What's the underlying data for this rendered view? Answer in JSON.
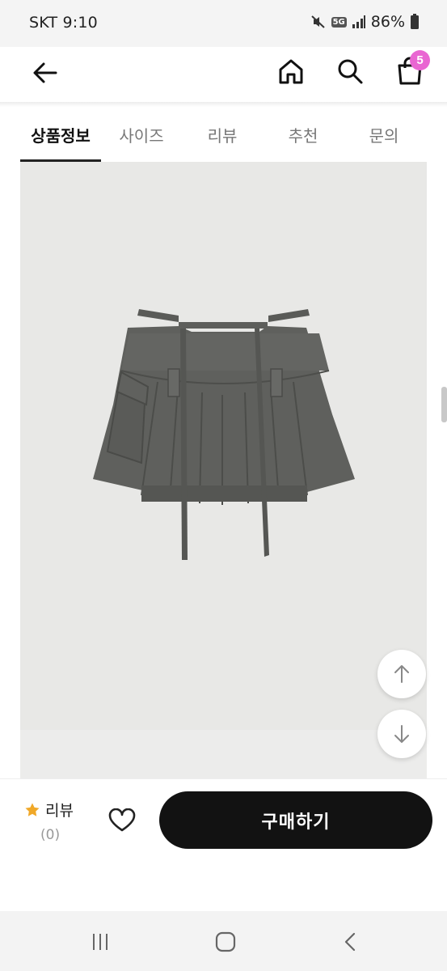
{
  "status_bar": {
    "carrier_time": "SKT 9:10",
    "network": "5G",
    "battery": "86%"
  },
  "header": {
    "cart_count": "5",
    "icons": [
      "back-arrow-icon",
      "home-icon",
      "search-icon",
      "shopping-bag-icon"
    ],
    "badge_color": "#e966d2"
  },
  "tabs": [
    {
      "label": "상품정보",
      "active": true
    },
    {
      "label": "사이즈",
      "active": false
    },
    {
      "label": "리뷰",
      "active": false
    },
    {
      "label": "추천",
      "active": false
    },
    {
      "label": "문의",
      "active": false
    }
  ],
  "product": {
    "image": "gray pleated cargo mini skirt with belt straps"
  },
  "bottom_bar": {
    "review_label": "리뷰",
    "review_count": "(0)",
    "buy_label": "구매하기",
    "star_color": "#f0a828"
  }
}
